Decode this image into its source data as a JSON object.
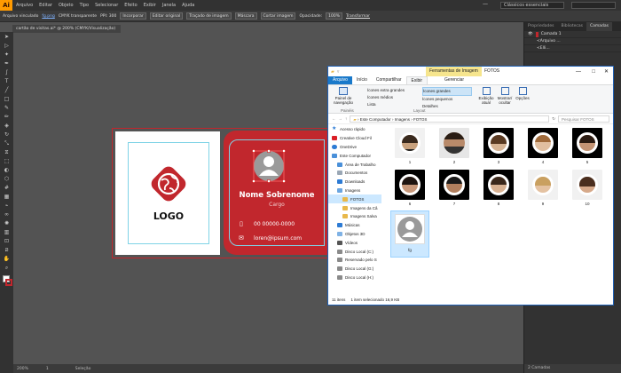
{
  "app": {
    "logo": "Ai",
    "menus": [
      "Arquivo",
      "Editar",
      "Objeto",
      "Tipo",
      "Selecionar",
      "Efeito",
      "Exibir",
      "Janela",
      "Ajuda"
    ],
    "workspace": "Clássicos essenciais",
    "minimize": "—",
    "maximize": "□",
    "close": "✕"
  },
  "control_bar": {
    "items": [
      "Arquivo vinculado",
      "fg.png",
      "CMYK transparente",
      "PPI: 300"
    ],
    "buttons": [
      "Incorporar",
      "Editar original",
      "Traçado de imagem",
      "Máscara",
      "Cortar imagem"
    ],
    "opacity_label": "Opacidade:",
    "opacity_value": "100%",
    "transform": "Transformar"
  },
  "doc_tab": "cartão de visitas.ai* @ 200% (CMYK/Visualização)",
  "panel": {
    "tabs": [
      "Propriedades",
      "Bibliotecas",
      "Camadas"
    ],
    "layers": [
      "Camada 1",
      "<Arquivo ...",
      "<Elli..."
    ],
    "footer": "2 Camadas"
  },
  "status": {
    "zoom": "200%",
    "page": "1",
    "mode": "Seleção"
  },
  "card": {
    "logo_text": "LOGO",
    "name": "Nome Sobrenome",
    "role": "Cargo",
    "phone": "00 00000-0000",
    "email": "loren@ipsum.com"
  },
  "explorer": {
    "title": "FOTOS",
    "tools_tab": "Ferramentas de Imagem",
    "tabs": [
      "Arquivo",
      "Início",
      "Compartilhar",
      "Exibir",
      "Gerenciar"
    ],
    "ribbon": {
      "nav_pane": "Painel de navegação",
      "layout_items": [
        "Ícones extra grandes",
        "Ícones grandes",
        "Ícones médios",
        "Ícones pequenos",
        "Lista",
        "Detalhes"
      ],
      "group_panels": "Painéis",
      "group_layout": "Layout",
      "current_view": "Exibição atual",
      "show_hide": "Mostrar/ ocultar",
      "options": "Opções"
    },
    "address": [
      "Este Computador",
      "Imagens",
      "FOTOS"
    ],
    "search_placeholder": "Pesquisar FOTOS",
    "nav": [
      "Acesso rápido",
      "Creative Cloud Fil",
      "OneDrive",
      "Este Computador",
      "Área de Trabalho",
      "Documentos",
      "Downloads",
      "Imagens",
      "FOTOS",
      "Imagens da Câ",
      "Imagens Salva",
      "Músicas",
      "Objetos 3D",
      "Vídeos",
      "Disco Local (C:)",
      "Reservado pelo S",
      "Disco Local (G:)",
      "Disco Local (H:)"
    ],
    "files": [
      "1",
      "2",
      "3",
      "4",
      "5",
      "6",
      "7",
      "8",
      "9",
      "10",
      "fg"
    ],
    "status_items": "11 itens",
    "status_selected": "1 item selecionado 16,9 KB"
  }
}
